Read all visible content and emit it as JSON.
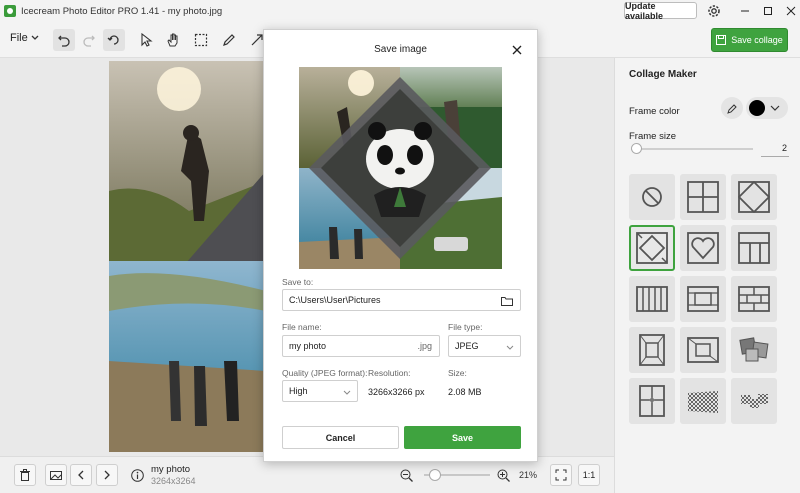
{
  "window": {
    "title": "Icecream Photo Editor PRO 1.41 - my photo.jpg",
    "update_label": "Update available",
    "accent": "#3fa33f"
  },
  "toolbar": {
    "file_label": "File",
    "save_collage_label": "Save collage",
    "tools": [
      "undo-icon",
      "redo-icon",
      "rotate-icon",
      "pointer-icon",
      "hand-icon",
      "select-icon",
      "pen-icon",
      "arrow-icon"
    ]
  },
  "bottombar": {
    "photo_name": "my photo",
    "photo_dims": "3264x3264",
    "zoom_percent": "21%",
    "fit_label": "1:1"
  },
  "panel": {
    "title": "Collage Maker",
    "frame_color_label": "Frame color",
    "frame_color": "#000000",
    "frame_size_label": "Frame size",
    "frame_size_value": "2",
    "selected_layout_index": 3,
    "layouts": [
      "none",
      "grid-2x2",
      "diamond",
      "diamond-selected",
      "heart",
      "grid-tall",
      "columns-6",
      "mosaic",
      "bricks",
      "frame-ornate",
      "center-frame",
      "polaroid",
      "split",
      "checker",
      "scatter"
    ]
  },
  "dialog": {
    "title": "Save image",
    "save_to_label": "Save to:",
    "save_to_value": "C:\\Users\\User\\Pictures",
    "file_name_label": "File name:",
    "file_name_value": "my photo",
    "file_ext": ".jpg",
    "file_type_label": "File type:",
    "file_type_value": "JPEG",
    "quality_label": "Quality (JPEG format):",
    "quality_value": "High",
    "resolution_label": "Resolution:",
    "resolution_value": "3266x3266 px",
    "size_label": "Size:",
    "size_value": "2.08 MB",
    "cancel_label": "Cancel",
    "save_label": "Save"
  }
}
